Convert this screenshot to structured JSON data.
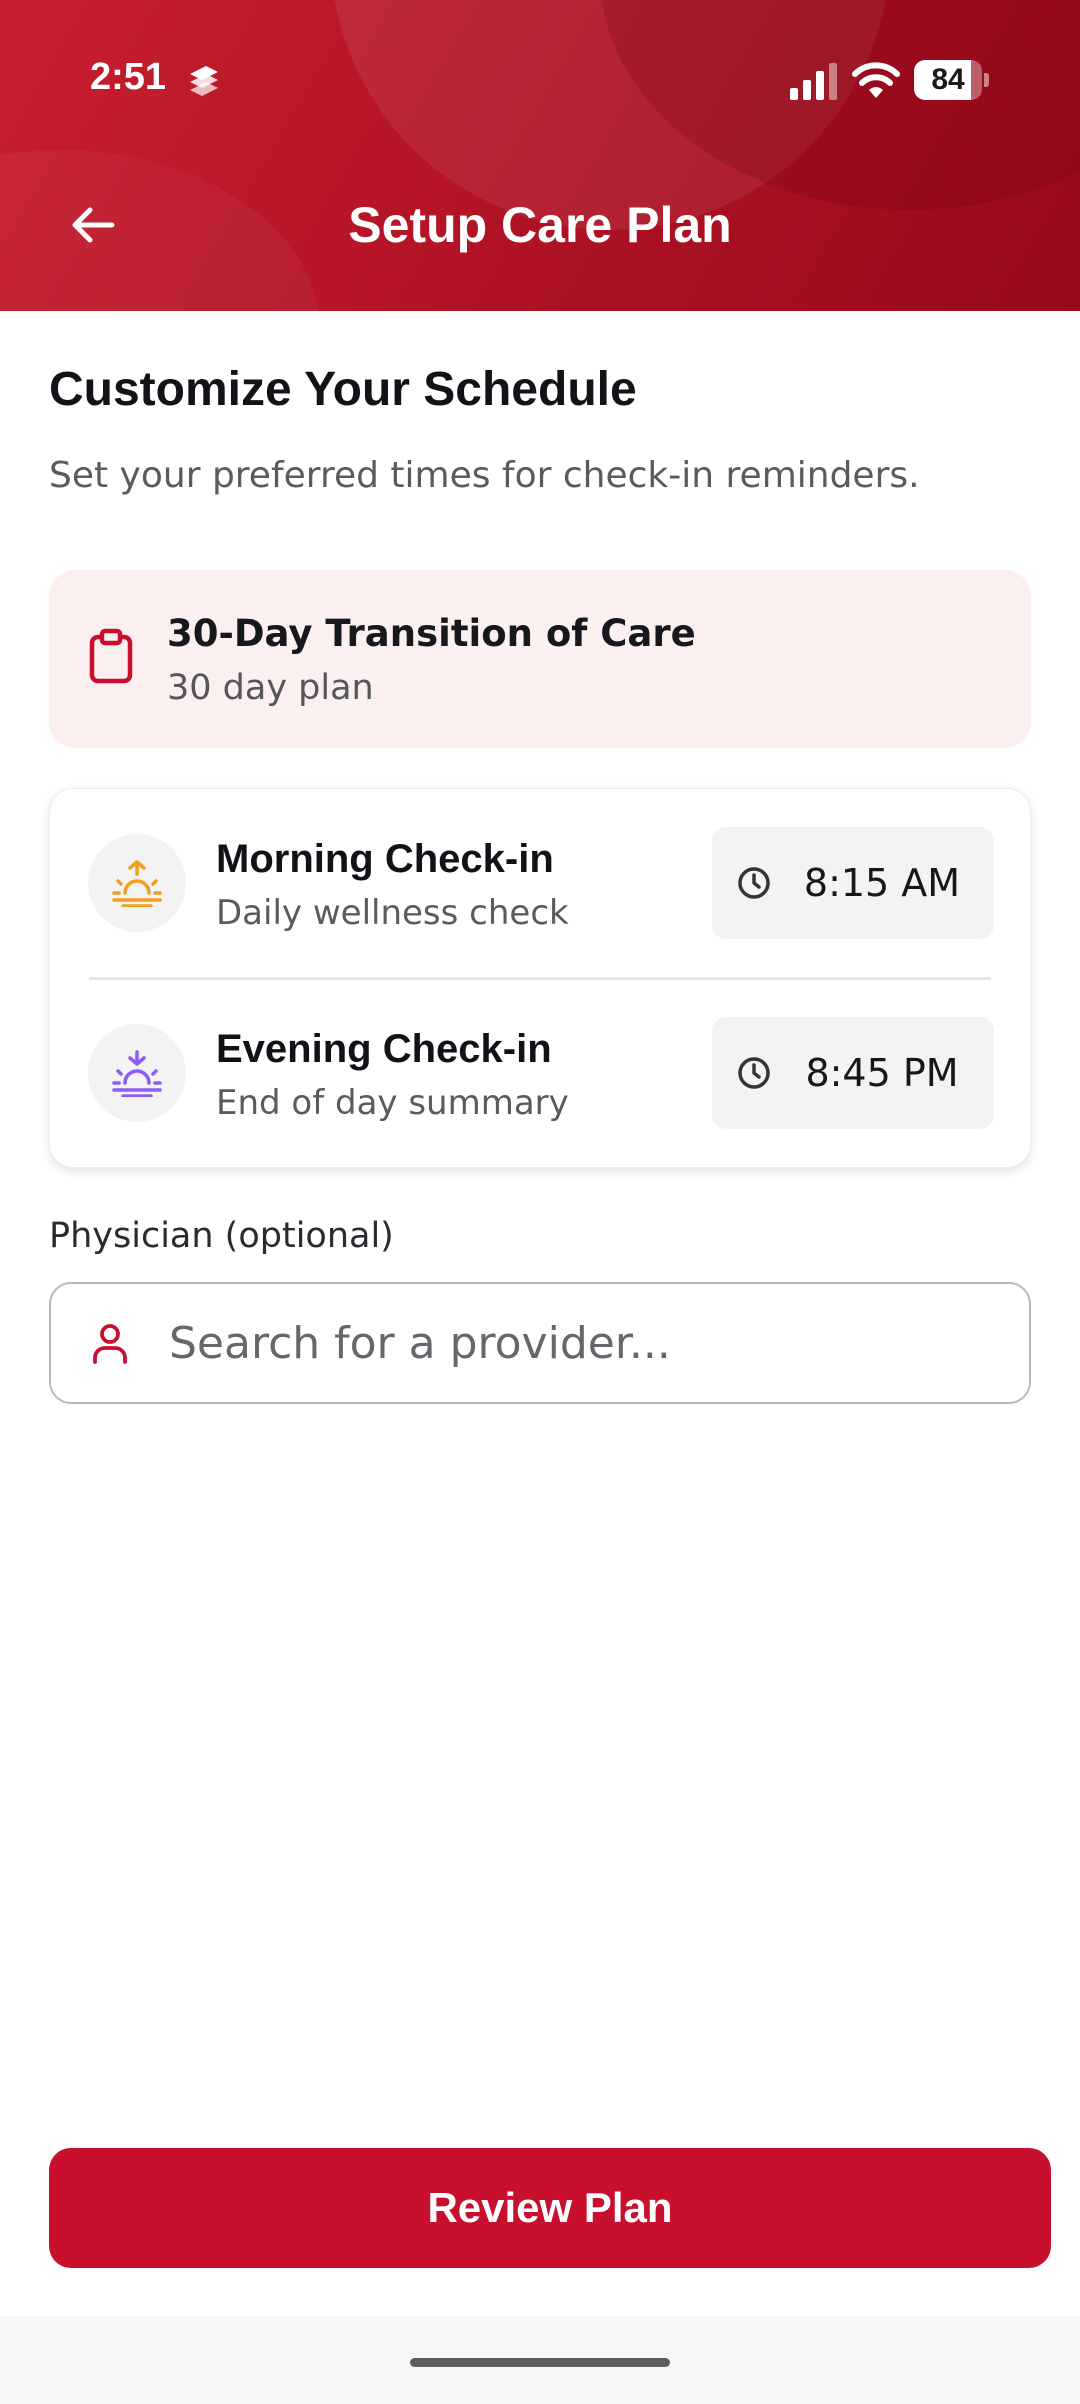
{
  "status_bar": {
    "time": "2:51",
    "battery_level": "84",
    "battery_fraction": 0.84
  },
  "header": {
    "title": "Setup Care Plan",
    "back_icon": "arrow-left-icon"
  },
  "intro": {
    "title": "Customize Your Schedule",
    "subtitle": "Set your preferred times for check-in reminders."
  },
  "plan": {
    "name": "30-Day Transition of Care",
    "duration": "30 day plan",
    "icon": "clipboard-icon"
  },
  "checkins": [
    {
      "title": "Morning Check-in",
      "description": "Daily wellness check",
      "time": "8:15 AM",
      "icon": "sunrise-icon",
      "icon_color": "#f0a020"
    },
    {
      "title": "Evening Check-in",
      "description": "End of day summary",
      "time": "8:45 PM",
      "icon": "sunset-icon",
      "icon_color": "#8b5cf6"
    }
  ],
  "physician": {
    "label": "Physician (optional)",
    "placeholder": "Search for a provider...",
    "value": ""
  },
  "actions": {
    "review_label": "Review Plan"
  },
  "colors": {
    "brand_red": "#c8102e",
    "header_red": "#b31426",
    "plan_card_bg": "#fcefef"
  }
}
